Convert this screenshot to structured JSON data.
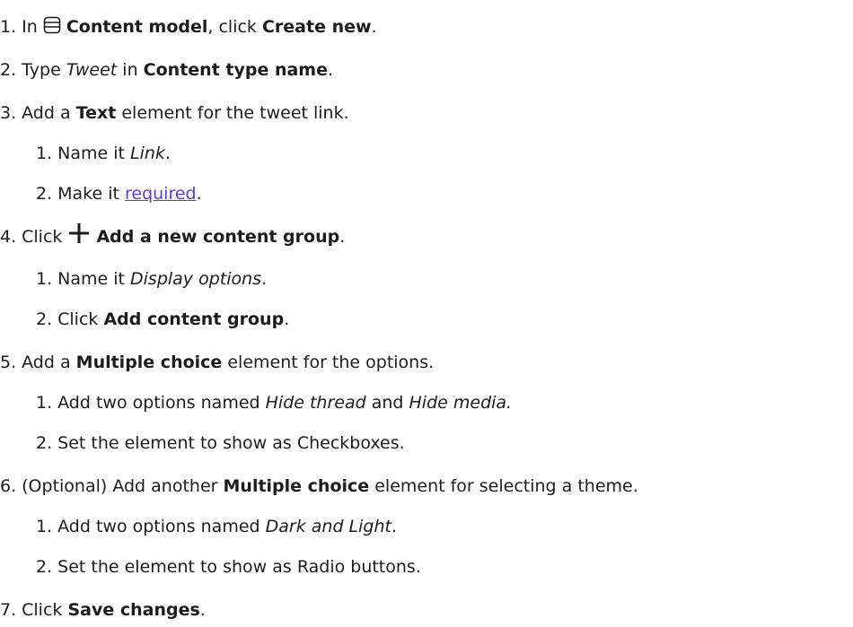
{
  "steps": [
    {
      "num": "1.",
      "t1": "In ",
      "icon": "content-model-icon",
      "b1": "Content model",
      "t2": ", click ",
      "b2": "Create new",
      "t3": "."
    },
    {
      "num": "2.",
      "t1": "Type ",
      "i1": "Tweet",
      "t2": " in ",
      "b1": "Content type name",
      "t3": "."
    },
    {
      "num": "3.",
      "t1": "Add a ",
      "b1": "Text",
      "t2": " element for the tweet link."
    },
    {
      "num": "1.",
      "t1": "Name it ",
      "i1": "Link",
      "t2": "."
    },
    {
      "num": "2.",
      "t1": "Make it ",
      "link": "required",
      "t2": "."
    },
    {
      "num": "4.",
      "t1": "Click ",
      "icon": "plus-icon",
      "b1": "Add a new content group",
      "t2": "."
    },
    {
      "num": "1.",
      "t1": "Name it ",
      "i1": "Display options",
      "t2": "."
    },
    {
      "num": "2.",
      "t1": "Click ",
      "b1": "Add content group",
      "t2": "."
    },
    {
      "num": "5.",
      "t1": "Add a ",
      "b1": "Multiple choice",
      "t2": " element for the options."
    },
    {
      "num": "1.",
      "t1": "Add two options named ",
      "i1": "Hide thread",
      "t2": " and ",
      "i2": "Hide media."
    },
    {
      "num": "2.",
      "t1": "Set the element to show as Checkboxes."
    },
    {
      "num": "6.",
      "t1": "(Optional) Add another ",
      "b1": "Multiple choice",
      "t2": " element for selecting a theme."
    },
    {
      "num": "1.",
      "t1": "Add two options named ",
      "i1": "Dark and Light",
      "t2": "."
    },
    {
      "num": "2.",
      "t1": "Set the element to show as Radio buttons."
    },
    {
      "num": "7.",
      "t1": "Click ",
      "b1": "Save changes",
      "t2": "."
    }
  ],
  "colors": {
    "text": "#1c1c1c",
    "link": "#5b3fcf"
  }
}
